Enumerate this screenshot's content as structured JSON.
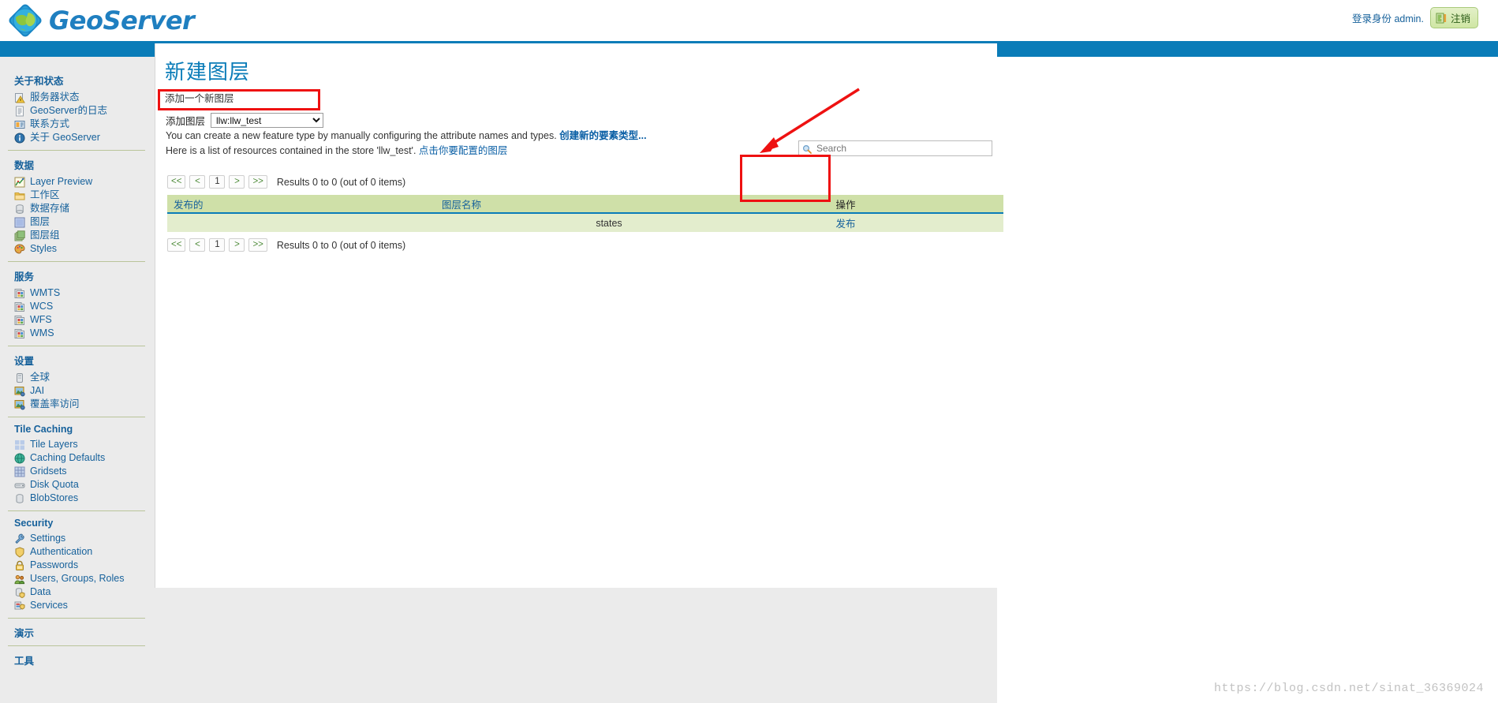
{
  "header": {
    "brand": "GeoServer",
    "logo_icon": "globe-icon",
    "login_text": "登录身份 admin.",
    "logout_label": "注销",
    "logout_icon": "door-exit-icon"
  },
  "sidebar": {
    "sections": [
      {
        "title": "关于和状态",
        "items": [
          {
            "label": "服务器状态",
            "icon": "server-status-icon"
          },
          {
            "label": "GeoServer的日志",
            "icon": "document-icon"
          },
          {
            "label": "联系方式",
            "icon": "contact-card-icon"
          },
          {
            "label": "关于 GeoServer",
            "icon": "info-icon"
          }
        ]
      },
      {
        "title": "数据",
        "items": [
          {
            "label": "Layer Preview",
            "icon": "layer-preview-icon"
          },
          {
            "label": "工作区",
            "icon": "folder-icon"
          },
          {
            "label": "数据存储",
            "icon": "database-icon"
          },
          {
            "label": "图层",
            "icon": "layer-icon"
          },
          {
            "label": "图层组",
            "icon": "layer-group-icon"
          },
          {
            "label": "Styles",
            "icon": "palette-icon"
          }
        ]
      },
      {
        "title": "服务",
        "items": [
          {
            "label": "WMTS",
            "icon": "service-icon"
          },
          {
            "label": "WCS",
            "icon": "service-icon"
          },
          {
            "label": "WFS",
            "icon": "service-icon"
          },
          {
            "label": "WMS",
            "icon": "service-icon"
          }
        ]
      },
      {
        "title": "设置",
        "items": [
          {
            "label": "全球",
            "icon": "globe-settings-icon"
          },
          {
            "label": "JAI",
            "icon": "image-settings-icon"
          },
          {
            "label": "覆盖率访问",
            "icon": "image-settings-icon"
          }
        ]
      },
      {
        "title": "Tile Caching",
        "items": [
          {
            "label": "Tile Layers",
            "icon": "tile-grid-icon"
          },
          {
            "label": "Caching Defaults",
            "icon": "globe-cache-icon"
          },
          {
            "label": "Gridsets",
            "icon": "grid-icon"
          },
          {
            "label": "Disk Quota",
            "icon": "disk-icon"
          },
          {
            "label": "BlobStores",
            "icon": "blobstore-icon"
          }
        ]
      },
      {
        "title": "Security",
        "items": [
          {
            "label": "Settings",
            "icon": "wrench-icon"
          },
          {
            "label": "Authentication",
            "icon": "shield-icon"
          },
          {
            "label": "Passwords",
            "icon": "lock-icon"
          },
          {
            "label": "Users, Groups, Roles",
            "icon": "users-icon"
          },
          {
            "label": "Data",
            "icon": "data-security-icon"
          },
          {
            "label": "Services",
            "icon": "services-security-icon"
          }
        ]
      },
      {
        "title": "演示",
        "items": []
      },
      {
        "title": "工具",
        "items": []
      }
    ]
  },
  "main": {
    "title": "新建图层",
    "subtitle": "添加一个新图层",
    "select_label": "添加图层",
    "select_value": "llw:llw_test",
    "select_options": [
      "llw:llw_test"
    ],
    "hint1_text": "You can create a new feature type by manually configuring the attribute names and types.",
    "hint1_link": "创建新的要素类型...",
    "hint2_text": "Here is a list of resources contained in the store 'llw_test'.",
    "hint2_link": "点击你要配置的图层",
    "search_placeholder": "Search",
    "search_value": "",
    "search_icon": "search-icon",
    "pager": {
      "first": "<<",
      "prev": "<",
      "page": "1",
      "next": ">",
      "last": ">>",
      "results_text": "Results 0 to 0 (out of 0 items)"
    },
    "table": {
      "headers": [
        "发布的",
        "图层名称",
        "操作",
        ""
      ],
      "rows": [
        {
          "published": "",
          "layer_name": "states",
          "action": "发布",
          "extra": ""
        }
      ]
    }
  },
  "annotations": {
    "box_select": "red-highlight-box",
    "box_action": "red-highlight-box",
    "arrow": "red-arrow"
  },
  "watermark": "https://blog.csdn.net/sinat_36369024",
  "colors": {
    "brand_blue": "#1f7fc0",
    "band_blue": "#0a7cb8",
    "link_blue": "#16619b",
    "green_line": "#8cb63c",
    "table_header_green": "#cfe0a8",
    "table_row_green": "#e3edcd",
    "annotation_red": "#ee1111"
  }
}
